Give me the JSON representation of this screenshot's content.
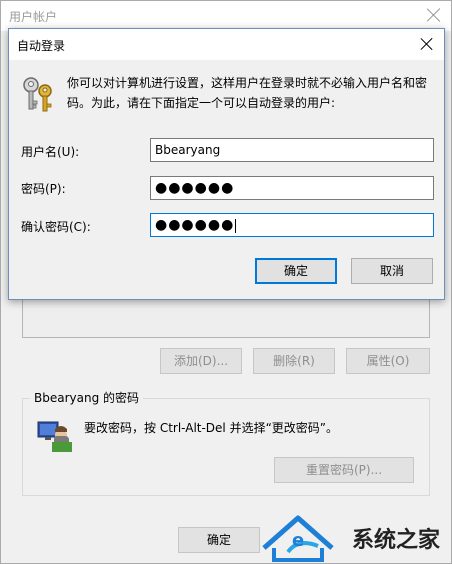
{
  "background_window": {
    "title": "用户帐户",
    "buttons": {
      "add": "添加(D)...",
      "remove": "删除(R)",
      "properties": "属性(O)"
    },
    "password_group": {
      "title": "Bbearyang 的密码",
      "info": "要改密码，按 Ctrl-Alt-Del 并选择“更改密码”。",
      "reset_button": "重置密码(P)..."
    },
    "ok_button": "确定"
  },
  "dialog": {
    "title": "自动登录",
    "description": "你可以对计算机进行设置，这样用户在登录时就不必输入用户名和密码。为此，请在下面指定一个可以自动登录的用户:",
    "fields": {
      "username_label": "用户名(U):",
      "username_value": "Bbearyang",
      "password_label": "密码(P):",
      "password_value": "●●●●●●",
      "confirm_label": "确认密码(C):",
      "confirm_value": "●●●●●●"
    },
    "ok_button": "确定",
    "cancel_button": "取消"
  },
  "watermark": {
    "text": "系统之家"
  },
  "colors": {
    "accent": "#0078d7",
    "window_bg": "#f0f0f0",
    "titlebar_bg": "#ffffff"
  },
  "icons": [
    "keys-icon",
    "user-icon",
    "close-icon"
  ]
}
